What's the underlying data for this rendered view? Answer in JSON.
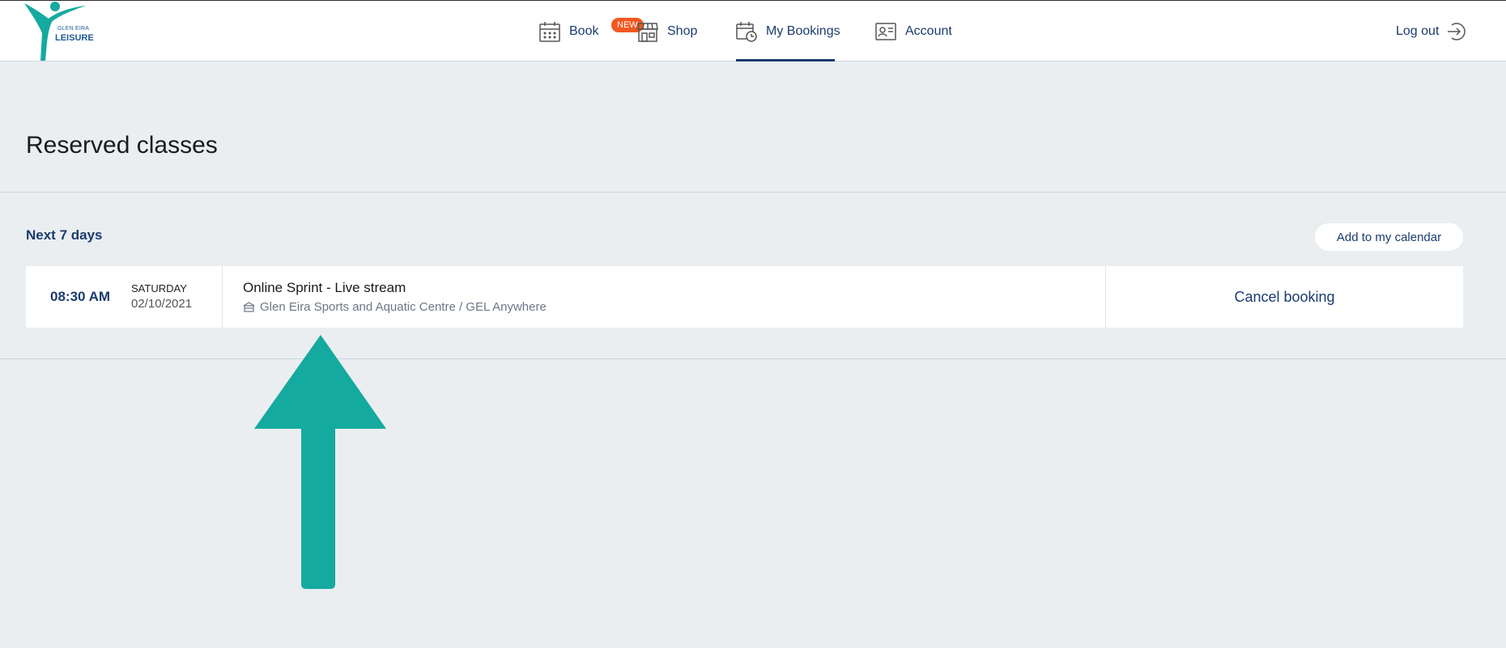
{
  "brand": {
    "line1": "GLEN EIRA",
    "line2": "LEISURE"
  },
  "nav": {
    "book": "Book",
    "new_badge": "NEW",
    "shop": "Shop",
    "my_bookings": "My Bookings",
    "account": "Account",
    "active": "My Bookings"
  },
  "logout": "Log out",
  "page": {
    "title": "Reserved classes"
  },
  "section": {
    "label": "Next 7 days",
    "calendar_button": "Add to my calendar"
  },
  "booking": {
    "time": "08:30 AM",
    "day": "SATURDAY",
    "date": "02/10/2021",
    "class_name": "Online Sprint - Live stream",
    "location": "Glen Eira Sports and Aquatic Centre / GEL Anywhere",
    "action": "Cancel booking"
  },
  "colors": {
    "primary": "#1b3b6f",
    "badge": "#f1571f",
    "arrow": "#14aaa0",
    "background": "#eaeef1"
  },
  "icons": [
    "calendar-icon",
    "shop-icon",
    "calendar-clock-icon",
    "id-card-icon",
    "logout-icon",
    "building-icon",
    "up-arrow-annotation"
  ]
}
